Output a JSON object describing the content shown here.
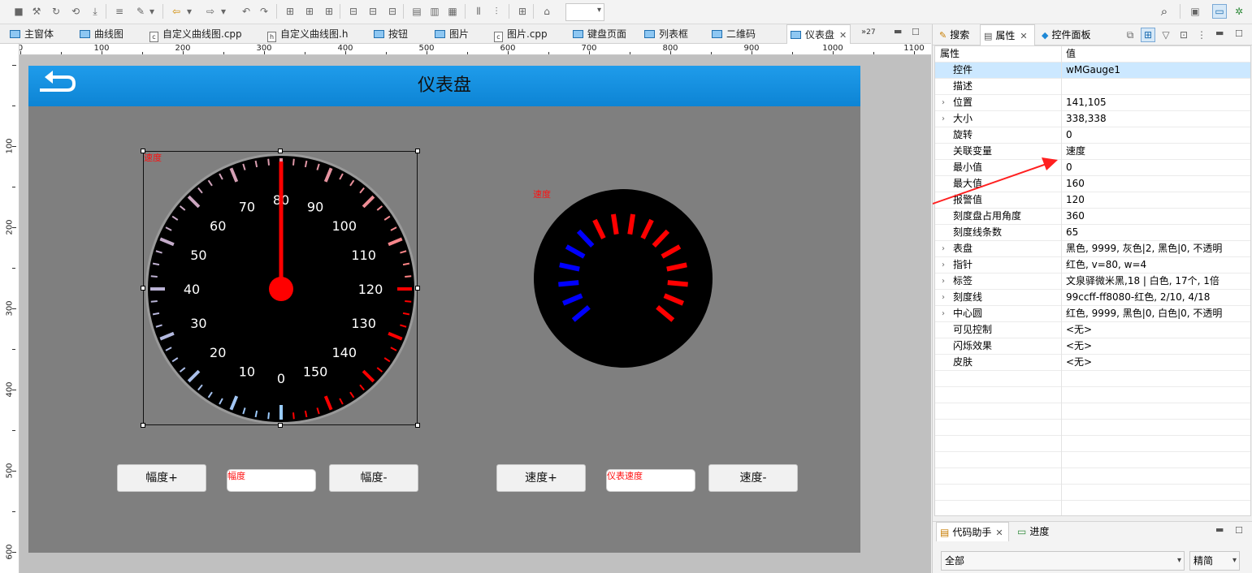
{
  "toolbar": {
    "right_icons": [
      "search-icon",
      "layout-icon",
      "perspective-icon",
      "debug-icon"
    ]
  },
  "editor": {
    "tabs": [
      {
        "label": "主窗体",
        "icon": "form-icon"
      },
      {
        "label": "曲线图",
        "icon": "form-icon"
      },
      {
        "label": "自定义曲线图.cpp",
        "icon": "cpp-file-icon"
      },
      {
        "label": "自定义曲线图.h",
        "icon": "h-file-icon"
      },
      {
        "label": "按钮",
        "icon": "form-icon"
      },
      {
        "label": "图片",
        "icon": "form-icon"
      },
      {
        "label": "图片.cpp",
        "icon": "cpp-file-icon"
      },
      {
        "label": "键盘页面",
        "icon": "form-icon"
      },
      {
        "label": "列表框",
        "icon": "form-icon"
      },
      {
        "label": "二维码",
        "icon": "form-icon"
      },
      {
        "label": "仪表盘",
        "icon": "form-icon",
        "active": true
      }
    ],
    "overflow_count": "27",
    "hruler_labels": [
      "0",
      "100",
      "200",
      "300",
      "400",
      "500",
      "600",
      "700",
      "800",
      "900",
      "1000",
      "1100"
    ],
    "vruler_labels": [
      "100",
      "200",
      "300",
      "400",
      "500",
      "600"
    ]
  },
  "canvas": {
    "title": "仪表盘",
    "gauge1": {
      "label": "速度",
      "min": 0,
      "max": 160,
      "value": 80,
      "alarm": 120,
      "tick_count": 65,
      "tick_labels": [
        "0",
        "10",
        "20",
        "30",
        "40",
        "50",
        "60",
        "70",
        "80",
        "90",
        "100",
        "110",
        "120",
        "130",
        "140",
        "150"
      ],
      "colors": {
        "dial": "#000000",
        "rim": "#999999",
        "needle": "#ff0000",
        "label": "#ffffff",
        "tick_normal": "#99ccff",
        "tick_alarm": "#ff0000",
        "tick_mid": "#ff8080"
      }
    },
    "gauge2": {
      "label": "速度",
      "colors": {
        "dial": "#000000",
        "tick_normal": "#0000ff",
        "tick_alarm": "#ff0000"
      }
    },
    "controls": {
      "amp_plus": "幅度+",
      "amp_field_label": "幅度",
      "amp_minus": "幅度-",
      "speed_plus": "速度+",
      "speed_field_label": "仪表速度",
      "speed_minus": "速度-"
    }
  },
  "panel": {
    "tabs": [
      "搜索",
      "属性",
      "控件面板"
    ],
    "header": {
      "name": "属性",
      "value": "值"
    },
    "rows": [
      {
        "name": "控件",
        "value": "wMGauge1",
        "expand": false,
        "selected": true
      },
      {
        "name": "描述",
        "value": "",
        "expand": false
      },
      {
        "name": "位置",
        "value": "141,105",
        "expand": true
      },
      {
        "name": "大小",
        "value": "338,338",
        "expand": true
      },
      {
        "name": "旋转",
        "value": "0",
        "expand": false
      },
      {
        "name": "关联变量",
        "value": "速度",
        "expand": false
      },
      {
        "name": "最小值",
        "value": "0",
        "expand": false
      },
      {
        "name": "最大值",
        "value": "160",
        "expand": false
      },
      {
        "name": "报警值",
        "value": "120",
        "expand": false
      },
      {
        "name": "刻度盘占用角度",
        "value": "360",
        "expand": false
      },
      {
        "name": "刻度线条数",
        "value": "65",
        "expand": false
      },
      {
        "name": "表盘",
        "value": "黑色, 9999, 灰色|2, 黑色|0, 不透明",
        "expand": true
      },
      {
        "name": "指针",
        "value": "红色, v=80, w=4",
        "expand": true
      },
      {
        "name": "标签",
        "value": "文泉驿微米黑,18 | 白色, 17个, 1倍",
        "expand": true
      },
      {
        "name": "刻度线",
        "value": "99ccff-ff8080-红色, 2/10, 4/18",
        "expand": true
      },
      {
        "name": "中心圆",
        "value": "红色, 9999, 黑色|0, 白色|0, 不透明",
        "expand": true
      },
      {
        "name": "可见控制",
        "value": "<无>",
        "expand": false
      },
      {
        "name": "闪烁效果",
        "value": "<无>",
        "expand": false
      },
      {
        "name": "皮肤",
        "value": "<无>",
        "expand": false
      }
    ],
    "code_tabs": [
      "代码助手",
      "进度"
    ],
    "filter_value": "全部",
    "mode_value": "精简"
  }
}
